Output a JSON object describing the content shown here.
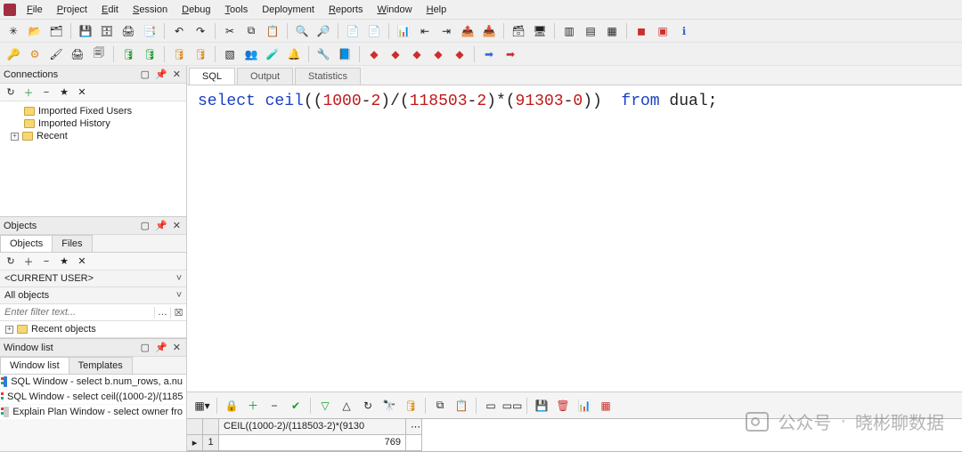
{
  "menu": {
    "items": [
      {
        "label": "File",
        "ul": "F"
      },
      {
        "label": "Project",
        "ul": "P"
      },
      {
        "label": "Edit",
        "ul": "E"
      },
      {
        "label": "Session",
        "ul": "S"
      },
      {
        "label": "Debug",
        "ul": "D"
      },
      {
        "label": "Tools",
        "ul": "T"
      },
      {
        "label": "Deployment",
        "ul": ""
      },
      {
        "label": "Reports",
        "ul": "R"
      },
      {
        "label": "Window",
        "ul": "W"
      },
      {
        "label": "Help",
        "ul": "H"
      }
    ]
  },
  "panels": {
    "connections": {
      "title": "Connections",
      "tree": [
        {
          "label": "Imported Fixed Users",
          "expandable": false
        },
        {
          "label": "Imported History",
          "expandable": false
        },
        {
          "label": "Recent",
          "expandable": true
        }
      ]
    },
    "objects": {
      "title": "Objects",
      "tabs": [
        "Objects",
        "Files"
      ],
      "currentUser": "<CURRENT USER>",
      "allObjects": "All objects",
      "filterPlaceholder": "Enter filter text...",
      "recent": "Recent objects"
    },
    "windowList": {
      "title": "Window list",
      "tabs": [
        "Window list",
        "Templates"
      ],
      "items": [
        "SQL Window - select b.num_rows, a.nu",
        "SQL Window - select ceil((1000-2)/(1185",
        "Explain Plan Window - select owner fro"
      ]
    }
  },
  "editor": {
    "tabs": [
      "SQL",
      "Output",
      "Statistics"
    ],
    "tokens": [
      {
        "t": "select ",
        "c": "kw"
      },
      {
        "t": "ceil",
        "c": "fn"
      },
      {
        "t": "((",
        "c": "plain"
      },
      {
        "t": "1000",
        "c": "num"
      },
      {
        "t": "-",
        "c": "plain"
      },
      {
        "t": "2",
        "c": "num"
      },
      {
        "t": ")/(",
        "c": "plain"
      },
      {
        "t": "118503",
        "c": "num"
      },
      {
        "t": "-",
        "c": "plain"
      },
      {
        "t": "2",
        "c": "num"
      },
      {
        "t": ")*(",
        "c": "plain"
      },
      {
        "t": "91303",
        "c": "num"
      },
      {
        "t": "-",
        "c": "plain"
      },
      {
        "t": "0",
        "c": "num"
      },
      {
        "t": "))  ",
        "c": "plain"
      },
      {
        "t": "from ",
        "c": "kw"
      },
      {
        "t": "dual",
        "c": "plain"
      },
      {
        "t": ";",
        "c": "plain"
      }
    ]
  },
  "results": {
    "columnHeader": "CEIL((1000-2)/(118503-2)*(9130",
    "rowNumber": "1",
    "value": "769"
  },
  "watermark": {
    "prefix": "公众号",
    "sep": "·",
    "name": "晓彬聊数据"
  }
}
